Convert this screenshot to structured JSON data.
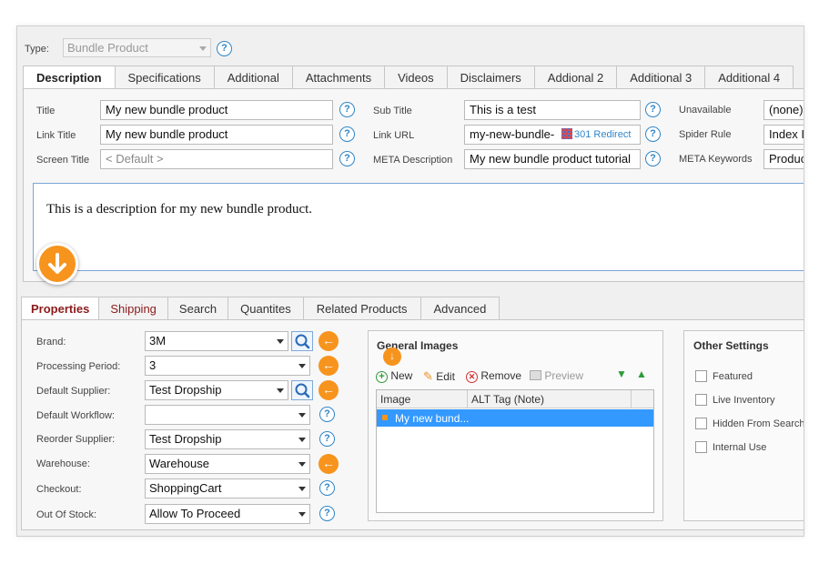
{
  "type_row": {
    "label": "Type:",
    "value": "Bundle Product"
  },
  "top_tabs": [
    "Description",
    "Specifications",
    "Additional",
    "Attachments",
    "Videos",
    "Disclaimers",
    "Addional 2",
    "Additional 3",
    "Additional 4"
  ],
  "fields": {
    "title": {
      "label": "Title",
      "value": "My new bundle product"
    },
    "link_title": {
      "label": "Link Title",
      "value": "My new bundle product"
    },
    "screen_title": {
      "label": "Screen Title",
      "placeholder": "< Default >"
    },
    "sub_title": {
      "label": "Sub Title",
      "value": "This is a test"
    },
    "link_url": {
      "label": "Link URL",
      "value": "my-new-bundle-",
      "badge": "301 Redirect"
    },
    "meta_description": {
      "label": "META Description",
      "value": "My new bundle product tutorial"
    },
    "unavailable": {
      "label": "Unavailable",
      "value": "(none)"
    },
    "spider_rule": {
      "label": "Spider Rule",
      "value": "Index I"
    },
    "meta_keywords": {
      "label": "META Keywords",
      "value": "Produc"
    }
  },
  "description_text": "This is a description for my new bundle product.",
  "bottom_tabs": [
    "Properties",
    "Shipping",
    "Search",
    "Quantites",
    "Related Products",
    "Advanced"
  ],
  "properties": {
    "brand": {
      "label": "Brand:",
      "value": "3M"
    },
    "processing_period": {
      "label": "Processing Period:",
      "value": "3"
    },
    "default_supplier": {
      "label": "Default Supplier:",
      "value": "Test Dropship"
    },
    "default_workflow": {
      "label": "Default Workflow:",
      "value": ""
    },
    "reorder_supplier": {
      "label": "Reorder Supplier:",
      "value": "Test Dropship"
    },
    "warehouse": {
      "label": "Warehouse:",
      "value": "Warehouse"
    },
    "checkout": {
      "label": "Checkout:",
      "value": "ShoppingCart"
    },
    "out_of_stock": {
      "label": "Out Of Stock:",
      "value": "Allow To Proceed"
    }
  },
  "general_images": {
    "title": "General Images",
    "toolbar": {
      "new": "New",
      "edit": "Edit",
      "remove": "Remove",
      "preview": "Preview"
    },
    "columns": [
      "Image",
      "ALT Tag (Note)"
    ],
    "rows": [
      {
        "image": "My new bund...",
        "alt": ""
      }
    ]
  },
  "other_settings": {
    "title": "Other Settings",
    "items": [
      "Featured",
      "Live Inventory",
      "Hidden From Search",
      "Internal Use"
    ]
  },
  "colors": {
    "accent_orange": "#f7941d",
    "selection_blue": "#3399ff",
    "help_blue": "#2f86c8",
    "dark_red": "#8b1a1a"
  }
}
